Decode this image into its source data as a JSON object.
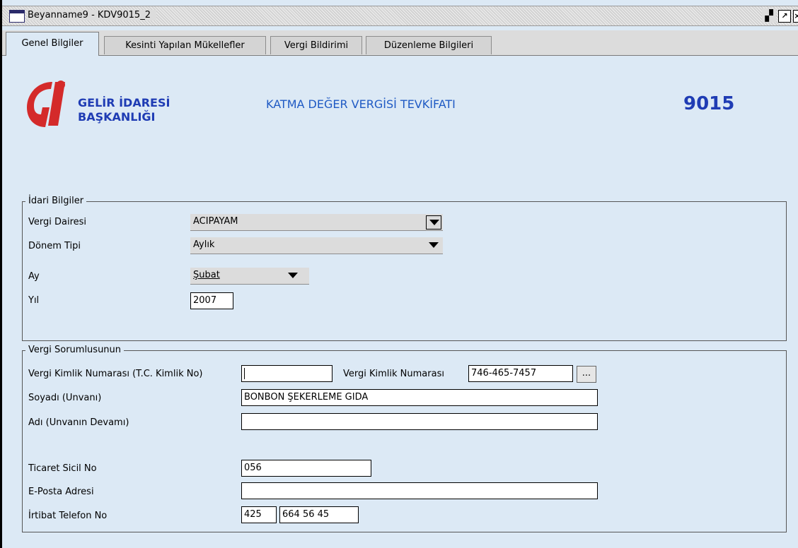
{
  "window": {
    "title": "Beyanname9 - KDV9015_2"
  },
  "tabs": [
    {
      "label": "Genel Bilgiler"
    },
    {
      "label": "Kesinti Yapılan Mükellefler"
    },
    {
      "label": "Vergi Bildirimi"
    },
    {
      "label": "Düzenleme Bilgileri"
    }
  ],
  "header": {
    "org_line1": "GELİR İDARESİ",
    "org_line2": "BAŞKANLIĞI",
    "form_title": "KATMA DEĞER VERGİSİ TEVKİFATI",
    "form_code": "9015"
  },
  "idari": {
    "legend": "İdari Bilgiler",
    "vergi_dairesi_label": "Vergi Dairesi",
    "vergi_dairesi_value": "ACIPAYAM",
    "donem_tipi_label": "Dönem Tipi",
    "donem_tipi_value": "Aylık",
    "ay_label": "Ay",
    "ay_value": "Şubat",
    "yil_label": "Yıl",
    "yil_value": "2007"
  },
  "sorumlu": {
    "legend": "Vergi Sorumlusunun",
    "tckn_label": "Vergi Kimlik Numarası (T.C. Kimlik No)",
    "tckn_value": "",
    "vkn_label": "Vergi Kimlik Numarası",
    "vkn_value": "746-465-7457",
    "browse_label": "...",
    "soyadi_label": "Soyadı (Unvanı)",
    "soyadi_value": "BONBON ŞEKERLEME GIDA",
    "adi_label": "Adı (Unvanın Devamı)",
    "adi_value": "",
    "ticaret_label": "Ticaret Sicil No",
    "ticaret_value": "056",
    "eposta_label": "E-Posta Adresi",
    "eposta_value": "",
    "telefon_label": "İrtibat Telefon No",
    "telefon_area": "425",
    "telefon_number": "664 56 45"
  },
  "colors": {
    "accent": "#1f3cb4",
    "logo_red": "#d42a2a",
    "panel_bg": "#dce9f5"
  }
}
